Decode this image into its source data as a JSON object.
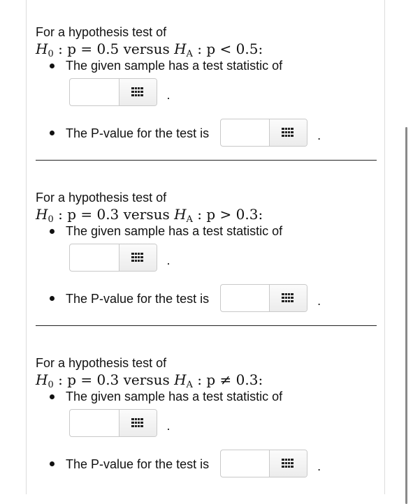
{
  "questions": [
    {
      "intro": "For a hypothesis test of",
      "hypothesis": {
        "h0_symbol": "H",
        "h0_sub": "0",
        "h0_rest": " : p = 0.5 versus ",
        "ha_symbol": "H",
        "ha_sub": "A",
        "ha_rest": " : p < 0.5:"
      },
      "test_statistic_label": "The given sample has a test statistic of",
      "test_statistic_value": "",
      "period": ".",
      "p_value_label": "The P-value for the test is",
      "p_value_value": "",
      "p_period": "."
    },
    {
      "intro": "For a hypothesis test of",
      "hypothesis": {
        "h0_symbol": "H",
        "h0_sub": "0",
        "h0_rest": " : p = 0.3 versus ",
        "ha_symbol": "H",
        "ha_sub": "A",
        "ha_rest": " : p > 0.3:"
      },
      "test_statistic_label": "The given sample has a test statistic of",
      "test_statistic_value": "",
      "period": ".",
      "p_value_label": "The P-value for the test is",
      "p_value_value": "",
      "p_period": "."
    },
    {
      "intro": "For a hypothesis test of",
      "hypothesis": {
        "h0_symbol": "H",
        "h0_sub": "0",
        "h0_rest": " : p = 0.3 versus ",
        "ha_symbol": "H",
        "ha_sub": "A",
        "ha_rest": " : p ≠ 0.3:"
      },
      "test_statistic_label": "The given sample has a test statistic of",
      "test_statistic_value": "",
      "period": ".",
      "p_value_label": "The P-value for the test is",
      "p_value_value": "",
      "p_period": "."
    }
  ],
  "icons": {
    "keypad": "keypad-grid-icon"
  },
  "colors": {
    "text": "#111111",
    "border": "#c9c9c9",
    "divider": "#222222",
    "scrollbar": "#8a8a8a"
  }
}
